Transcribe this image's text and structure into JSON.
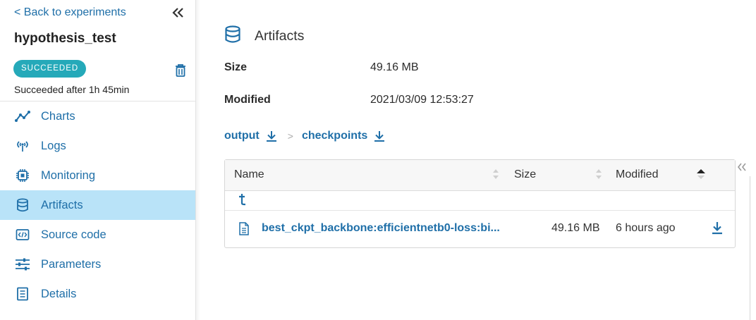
{
  "sidebar": {
    "back_label": "< Back to experiments",
    "experiment_name": "hypothesis_test",
    "status_badge": "SUCCEEDED",
    "status_text": "Succeeded after 1h 45min",
    "items": [
      {
        "label": "Charts",
        "icon": "chart-line-icon"
      },
      {
        "label": "Logs",
        "icon": "broadcast-icon"
      },
      {
        "label": "Monitoring",
        "icon": "cpu-chip-icon"
      },
      {
        "label": "Artifacts",
        "icon": "database-icon",
        "active": true
      },
      {
        "label": "Source code",
        "icon": "code-icon"
      },
      {
        "label": "Parameters",
        "icon": "sliders-icon"
      },
      {
        "label": "Details",
        "icon": "document-list-icon"
      }
    ]
  },
  "main": {
    "title": "Artifacts",
    "meta": {
      "size_label": "Size",
      "size_value": "49.16 MB",
      "modified_label": "Modified",
      "modified_value": "2021/03/09 12:53:27"
    },
    "breadcrumbs": [
      "output",
      "checkpoints"
    ],
    "breadcrumb_separator": ">",
    "table": {
      "columns": [
        "Name",
        "Size",
        "Modified"
      ],
      "sorted_column": "Modified",
      "up_symbol": "t",
      "rows": [
        {
          "name": "best_ckpt_backbone:efficientnetb0-loss:bi...",
          "size": "49.16 MB",
          "modified": "6 hours ago"
        }
      ]
    }
  },
  "colors": {
    "accent": "#1f6fa8",
    "badge": "#25a9b9",
    "active_nav": "#b9e3f8"
  }
}
